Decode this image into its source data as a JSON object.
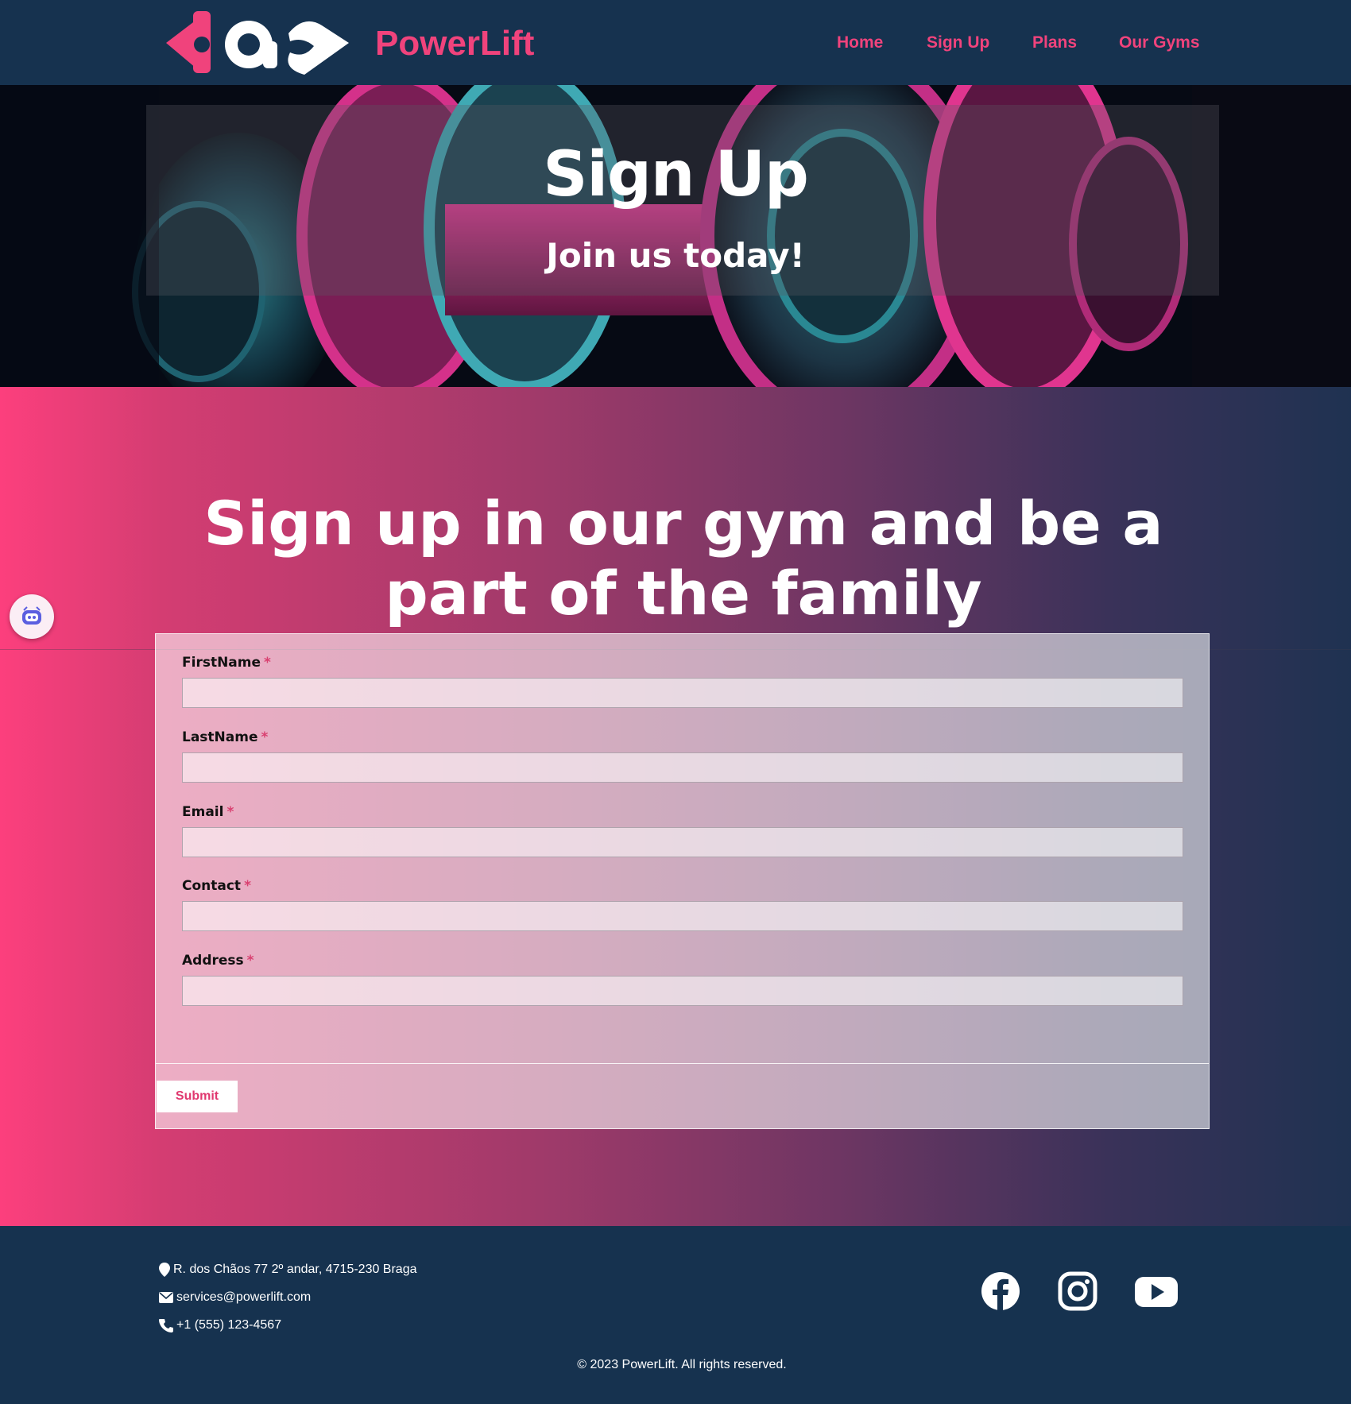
{
  "header": {
    "brand": "PowerLift",
    "nav": [
      "Home",
      "Sign Up",
      "Plans",
      "Our Gyms"
    ]
  },
  "hero": {
    "title": "Sign Up",
    "subtitle": "Join us today!"
  },
  "main": {
    "title": "Sign up in our gym and be a part of the family"
  },
  "form": {
    "fields": [
      {
        "label": "FirstName",
        "required": "*",
        "value": ""
      },
      {
        "label": "LastName",
        "required": "*",
        "value": ""
      },
      {
        "label": "Email",
        "required": "*",
        "value": ""
      },
      {
        "label": "Contact",
        "required": "*",
        "value": ""
      },
      {
        "label": "Address",
        "required": "*",
        "value": ""
      }
    ],
    "submit_label": "Submit"
  },
  "footer": {
    "address": "R. dos Chãos 77 2º andar, 4715-230 Braga",
    "email": "services@powerlift.com",
    "phone": "+1 (555) 123-4567",
    "copyright": "© 2023 PowerLift. All rights reserved.",
    "social": [
      "facebook-icon",
      "instagram-icon",
      "youtube-icon"
    ]
  },
  "colors": {
    "brand_pink": "#f0437c",
    "navy": "#16324f",
    "white": "#ffffff"
  }
}
